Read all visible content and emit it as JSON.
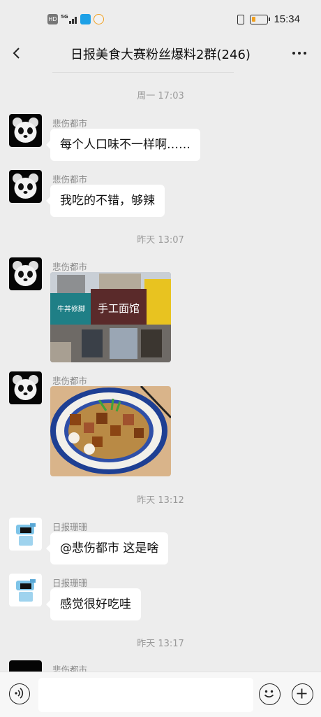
{
  "status_bar": {
    "time": "15:34",
    "hd_label": "HD",
    "network_label": "5G",
    "battery_level": 0.25,
    "icons": [
      "hd-icon",
      "signal-icon",
      "qq-browser-icon",
      "weibo-icon",
      "vibrate-icon",
      "battery-icon"
    ]
  },
  "header": {
    "title": "日报美食大赛粉丝爆料2群(246)",
    "back_icon": "chevron-left-icon",
    "more_icon": "more-dots-icon"
  },
  "messages": [
    {
      "type": "timestamp",
      "text": "周一 17:03"
    },
    {
      "type": "text",
      "sender": "悲伤都市",
      "avatar": "panda-avatar",
      "text": "每个人口味不一样啊……"
    },
    {
      "type": "text",
      "sender": "悲伤都市",
      "avatar": "panda-avatar",
      "text": "我吃的不错，够辣"
    },
    {
      "type": "timestamp",
      "text": "昨天 13:07"
    },
    {
      "type": "image",
      "sender": "悲伤都市",
      "avatar": "panda-avatar",
      "image": "restaurant-storefront-photo",
      "sign_text": [
        "手工面馆",
        "牛丼修脚"
      ]
    },
    {
      "type": "image",
      "sender": "悲伤都市",
      "avatar": "panda-avatar",
      "image": "beef-noodle-bowl-photo"
    },
    {
      "type": "timestamp",
      "text": "昨天 13:12"
    },
    {
      "type": "text",
      "sender": "日报珊珊",
      "avatar": "robot-avatar",
      "text": "@悲伤都市  这是啥"
    },
    {
      "type": "text",
      "sender": "日报珊珊",
      "avatar": "robot-avatar",
      "text": "感觉很好吃哇"
    },
    {
      "type": "timestamp",
      "text": "昨天 13:17"
    },
    {
      "type": "partial",
      "sender": "悲伤都市",
      "avatar": "panda-avatar"
    }
  ],
  "input_bar": {
    "voice_icon": "voice-icon",
    "text_value": "",
    "placeholder": "",
    "emoji_icon": "emoji-icon",
    "plus_icon": "plus-icon"
  }
}
